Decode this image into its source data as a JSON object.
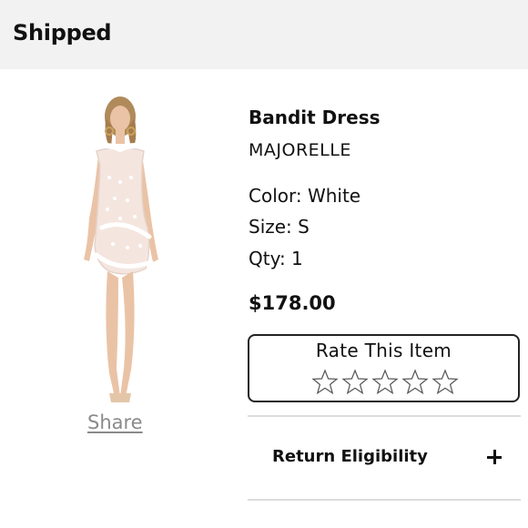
{
  "header": {
    "title": "Shipped"
  },
  "product": {
    "name": "Bandit Dress",
    "brand": "MAJORELLE",
    "color": "Color: White",
    "size": "Size: S",
    "qty": "Qty: 1",
    "price": "$178.00",
    "image_icon": "dress-photo"
  },
  "share": {
    "label": "Share"
  },
  "rating": {
    "title": "Rate This Item",
    "star_count": 5,
    "stars_filled": 0
  },
  "return_eligibility": {
    "label": "Return Eligibility",
    "toggle_icon": "plus-icon"
  },
  "colors": {
    "header_bg": "#f2f2f2",
    "text": "#111111",
    "link": "#8a8a8a",
    "divider": "#dcdcdc"
  }
}
